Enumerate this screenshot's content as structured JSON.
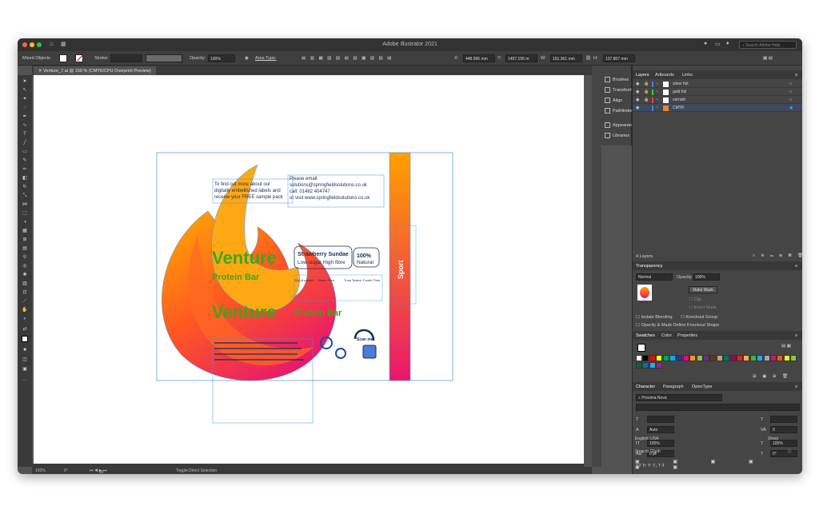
{
  "window": {
    "title": "Adobe Illustrator 2021",
    "search_placeholder": "Search Adobe Help",
    "colors": {
      "accent": "#1473e6",
      "flame_orange": "#ff8a00",
      "flame_pink": "#e8186c",
      "green": "#3ea61b"
    }
  },
  "control_bar": {
    "selection": "Mixed Objects",
    "stroke_label": "Stroke:",
    "opacity_label": "Opacity:",
    "opacity_value": "100%",
    "area_type": "Area Type:",
    "x_label": "X:",
    "x_value": "448.996 mm",
    "y_label": "Y:",
    "y_value": "1497.195 m",
    "w_label": "W:",
    "w_value": "151.361 mm",
    "h_label": "H:",
    "h_value": "137.807 mm"
  },
  "document_tab": {
    "label": "Venture_7.ai @ 150 % (CMYK/CPU Overprint Preview)"
  },
  "status_bar": {
    "zoom": "150%",
    "rotation": "0°",
    "artboard": "19",
    "mode": "Toggle Direct Selection"
  },
  "side_panels": [
    {
      "label": "Brushes",
      "icon": "brush-icon"
    },
    {
      "label": "Transform",
      "icon": "transform-icon"
    },
    {
      "label": "Align",
      "icon": "align-icon"
    },
    {
      "label": "Pathfinder",
      "icon": "pathfinder-icon"
    },
    {
      "label": "Appearan...",
      "icon": "appearance-icon"
    },
    {
      "label": "Libraries",
      "icon": "libraries-icon"
    }
  ],
  "layers_panel": {
    "tabs": [
      "Layers",
      "Artboards",
      "Links"
    ],
    "layers": [
      {
        "name": "silver foil",
        "color": "#4d7be0"
      },
      {
        "name": "gold foil",
        "color": "#3cc43c"
      },
      {
        "name": "varnish",
        "color": "#e04040"
      },
      {
        "name": "CMYK",
        "color": "#4d7be0"
      }
    ],
    "count": "4 Layers"
  },
  "transparency_panel": {
    "title": "Transparency",
    "blend_mode": "Normal",
    "opacity_label": "Opacity:",
    "opacity_value": "100%",
    "make_mask": "Make Mask",
    "clip": "Clip",
    "invert_mask": "Invert Mask",
    "isolate_blending": "Isolate Blending",
    "knockout_group": "Knockout Group",
    "opacity_mask": "Opacity & Mask Define Knockout Shape"
  },
  "swatches_panel": {
    "tabs": [
      "Swatches",
      "Color",
      "Properties"
    ],
    "swatches": [
      "#ffffff",
      "#000000",
      "#ff0000",
      "#ffff00",
      "#00a651",
      "#00aeef",
      "#2e3192",
      "#ec008c",
      "#f7941d",
      "#8dc63f",
      "#662d91",
      "#603913",
      "#c69c6d",
      "#00746b",
      "#9e005d",
      "#ed1c24",
      "#fbb040",
      "#39b54a",
      "#27aae1",
      "#a7a9ac",
      "#d4145a",
      "#f15a24",
      "#fcee21",
      "#8cc63f",
      "#006837",
      "#0071bc",
      "#29abe2",
      "#93278f"
    ]
  },
  "character_panel": {
    "tabs": [
      "Character",
      "Paragraph",
      "OpenType"
    ],
    "font_family": "Proxima Nova",
    "leading": "Auto",
    "tracking": "0",
    "h_scale": "100%",
    "v_scale": "100%",
    "baseline": "0 pt",
    "rotation": "0°",
    "language": "English: USA",
    "antialias": "Sharp",
    "snap_label": "Snap to Glyph"
  },
  "artwork": {
    "contact_text": [
      "To find out more about our",
      "digitally embellished labels and",
      "receive your FREE sample pack",
      "Please email:",
      "solutions@springfieldsolutions.co.uk",
      "call: 01482 404747",
      "or visit www.springfieldsolutions.co.uk"
    ],
    "brand": "Venture",
    "product": "Protein Bar",
    "flavour": "Strawberry Sundae",
    "tagline": "Low sugar High fibre",
    "natural_pct": "100%",
    "natural": "Natural",
    "icon_labels": [
      "25g of protein",
      "Gluten Free",
      "Trust Tested",
      "Fourth Time"
    ],
    "side_label": "Sport",
    "scan_label": "Scan me"
  }
}
